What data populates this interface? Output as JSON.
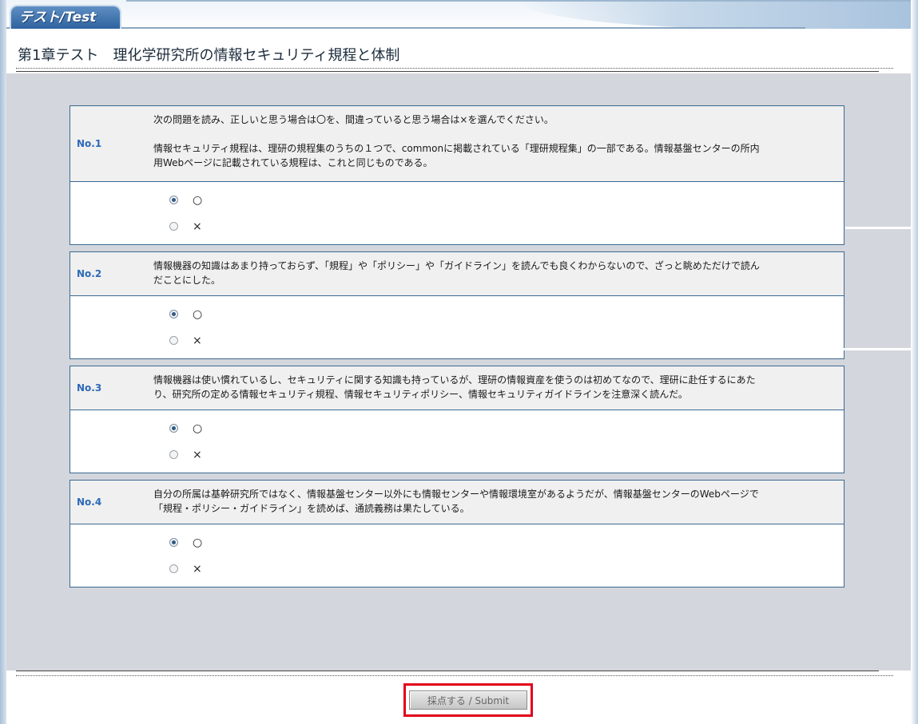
{
  "header": {
    "tab_label": "テスト/Test",
    "page_title": "第1章テスト　理化学研究所の情報セキュリティ規程と体制"
  },
  "questions": [
    {
      "number": "No.1",
      "text": "次の問題を読み、正しいと思う場合は〇を、間違っていると思う場合は×を選んでください。\n\n情報セキュリティ規程は、理研の規程集のうちの１つで、commonに掲載されている「理研規程集」の一部である。情報基盤センターの所内用Webページに記載されている規程は、これと同じものである。",
      "options": [
        {
          "label": "○",
          "checked": true
        },
        {
          "label": "×",
          "checked": false
        }
      ]
    },
    {
      "number": "No.2",
      "text": "情報機器の知識はあまり持っておらず、「規程」や「ポリシー」や「ガイドライン」を読んでも良くわからないので、ざっと眺めただけで読んだことにした。",
      "options": [
        {
          "label": "○",
          "checked": true
        },
        {
          "label": "×",
          "checked": false
        }
      ]
    },
    {
      "number": "No.3",
      "text": "情報機器は使い慣れているし、セキュリティに関する知識も持っているが、理研の情報資産を使うのは初めてなので、理研に赴任するにあたり、研究所の定める情報セキュリティ規程、情報セキュリティポリシー、情報セキュリティガイドラインを注意深く読んだ。",
      "options": [
        {
          "label": "○",
          "checked": true
        },
        {
          "label": "×",
          "checked": false
        }
      ]
    },
    {
      "number": "No.4",
      "text": "自分の所属は基幹研究所ではなく、情報基盤センター以外にも情報センターや情報環境室があるようだが、情報基盤センターのWebページで「規程・ポリシー・ガイドライン」を読めば、通読義務は果たしている。",
      "options": [
        {
          "label": "○",
          "checked": true
        },
        {
          "label": "×",
          "checked": false
        }
      ]
    }
  ],
  "submit": {
    "label": "採点する / Submit"
  },
  "colors": {
    "accent": "#2d6ab8",
    "border": "#3b6a92",
    "panel": "#d3d6dc",
    "highlight": "#e1001a"
  }
}
